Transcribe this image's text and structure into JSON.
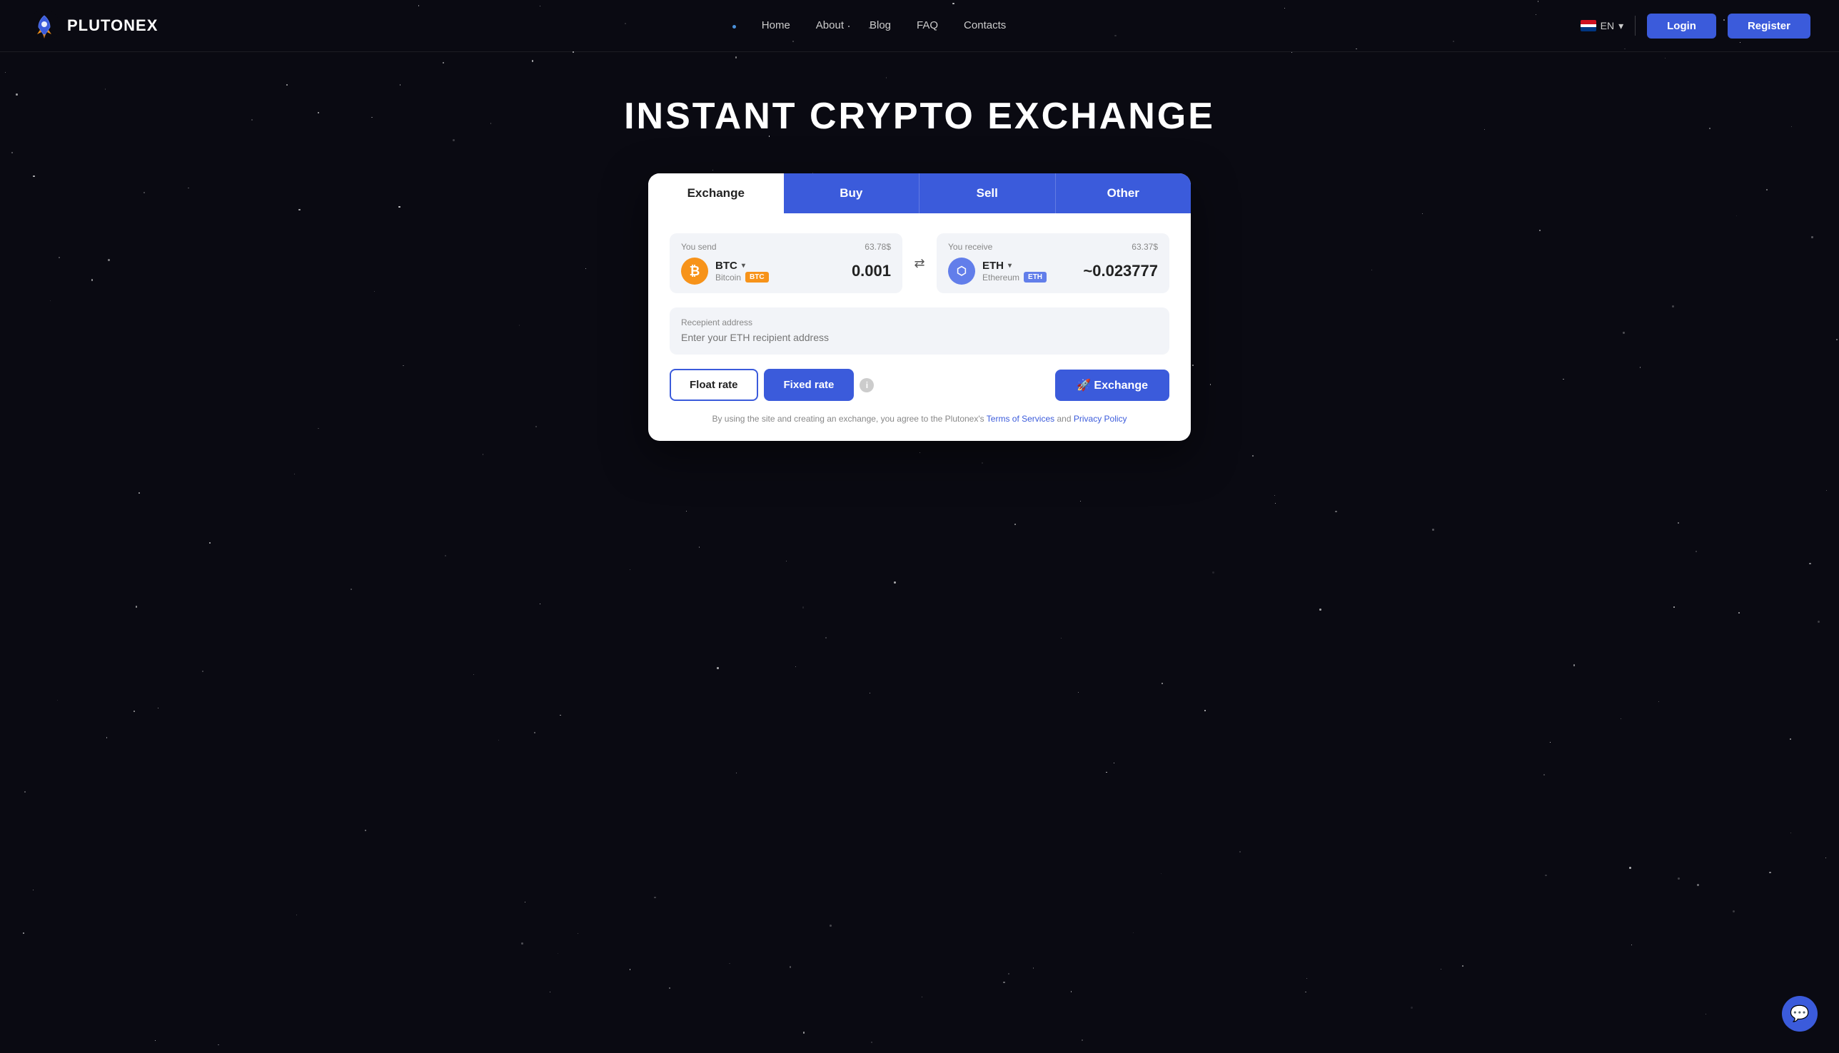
{
  "brand": {
    "name": "PLUTONEX"
  },
  "nav": {
    "dot": "•",
    "links": [
      {
        "label": "Home",
        "href": "#"
      },
      {
        "label": "About",
        "href": "#"
      },
      {
        "label": "Blog",
        "href": "#"
      },
      {
        "label": "FAQ",
        "href": "#"
      },
      {
        "label": "Contacts",
        "href": "#"
      }
    ],
    "language": "EN",
    "login_label": "Login",
    "register_label": "Register"
  },
  "hero": {
    "title": "INSTANT CRYPTO EXCHANGE"
  },
  "tabs": [
    {
      "label": "Exchange",
      "key": "exchange"
    },
    {
      "label": "Buy",
      "key": "buy"
    },
    {
      "label": "Sell",
      "key": "sell"
    },
    {
      "label": "Other",
      "key": "other"
    }
  ],
  "exchange": {
    "send": {
      "label": "You send",
      "usd": "63.78$",
      "coin": "BTC",
      "chevron": "▾",
      "coin_full": "Bitcoin",
      "badge": "BTC",
      "amount": "0.001"
    },
    "receive": {
      "label": "You receive",
      "usd": "63.37$",
      "coin": "ETH",
      "chevron": "▾",
      "coin_full": "Ethereum",
      "badge": "ETH",
      "amount": "~0.023777"
    },
    "recipient": {
      "label": "Recepient address",
      "placeholder": "Enter your ETH recipient address"
    },
    "float_label": "Float rate",
    "fixed_label": "Fixed rate",
    "exchange_label": "🚀 Exchange",
    "terms_text": "By using the site and creating an exchange, you agree to the Plutonex's",
    "terms_of_service": "Terms of Services",
    "and_text": "and",
    "privacy_policy": "Privacy Policy"
  },
  "chat": {
    "icon": "💬"
  }
}
